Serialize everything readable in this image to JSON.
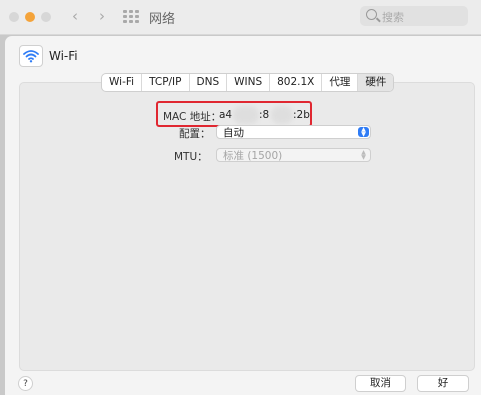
{
  "window": {
    "title": "网络"
  },
  "search": {
    "placeholder": "搜索"
  },
  "service": {
    "name": "Wi-Fi"
  },
  "tabs": [
    {
      "label": "Wi-Fi",
      "active": false
    },
    {
      "label": "TCP/IP",
      "active": false
    },
    {
      "label": "DNS",
      "active": false
    },
    {
      "label": "WINS",
      "active": false
    },
    {
      "label": "802.1X",
      "active": false
    },
    {
      "label": "代理",
      "active": false
    },
    {
      "label": "硬件",
      "active": true
    }
  ],
  "hardware": {
    "mac_label": "MAC 地址：",
    "mac_parts": [
      "a4",
      ":8",
      ":2b"
    ],
    "config_label": "配置：",
    "config_value": "自动",
    "mtu_label": "MTU：",
    "mtu_value": "标准 (1500)"
  },
  "buttons": {
    "help": "?",
    "cancel": "取消",
    "ok": "好"
  },
  "colors": {
    "highlight": "#e02731",
    "accent": "#2f7cf6",
    "min_button": "#f4a33a"
  },
  "icons": [
    "back-icon",
    "forward-icon",
    "grid-icon",
    "search-icon",
    "wifi-icon",
    "stepper-icon"
  ]
}
